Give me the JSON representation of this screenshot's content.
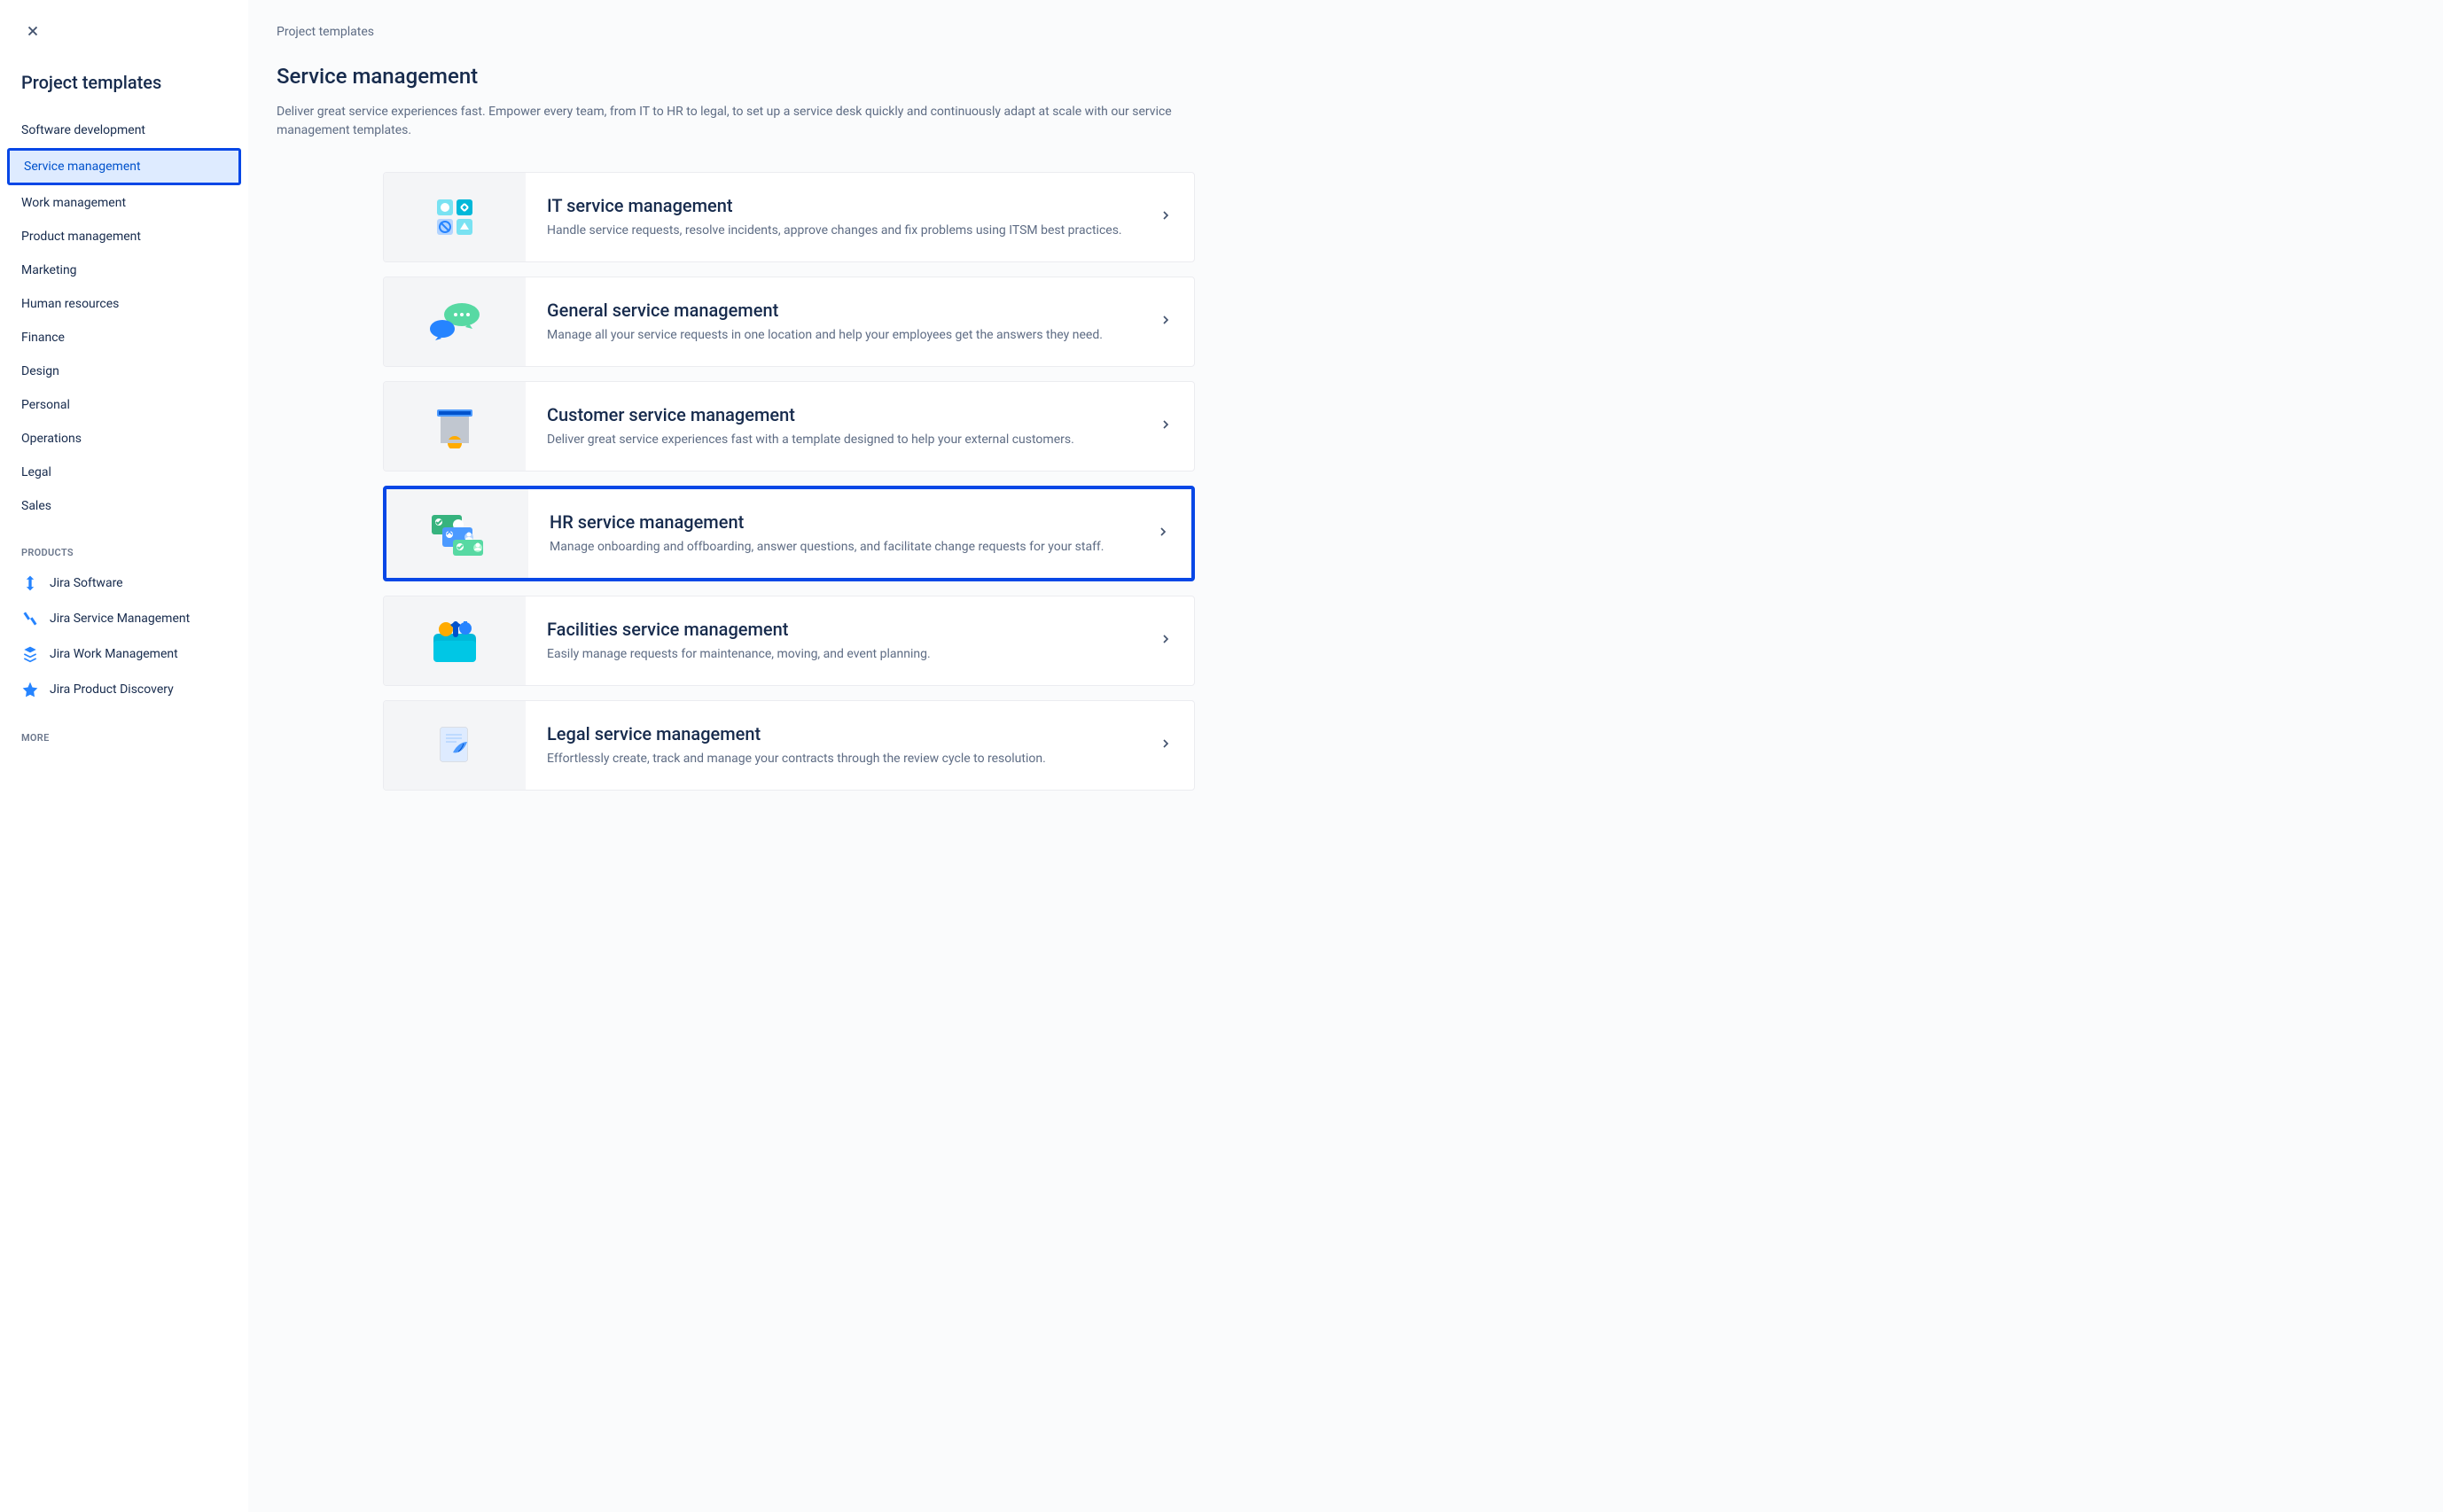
{
  "sidebar": {
    "title": "Project templates",
    "categories": [
      {
        "label": "Software development",
        "selected": false
      },
      {
        "label": "Service management",
        "selected": true
      },
      {
        "label": "Work management",
        "selected": false
      },
      {
        "label": "Product management",
        "selected": false
      },
      {
        "label": "Marketing",
        "selected": false
      },
      {
        "label": "Human resources",
        "selected": false
      },
      {
        "label": "Finance",
        "selected": false
      },
      {
        "label": "Design",
        "selected": false
      },
      {
        "label": "Personal",
        "selected": false
      },
      {
        "label": "Operations",
        "selected": false
      },
      {
        "label": "Legal",
        "selected": false
      },
      {
        "label": "Sales",
        "selected": false
      }
    ],
    "productsLabel": "PRODUCTS",
    "products": [
      {
        "label": "Jira Software",
        "icon": "jira-software"
      },
      {
        "label": "Jira Service Management",
        "icon": "jira-service"
      },
      {
        "label": "Jira Work Management",
        "icon": "jira-work"
      },
      {
        "label": "Jira Product Discovery",
        "icon": "jira-discovery"
      }
    ],
    "moreLabel": "MORE"
  },
  "main": {
    "breadcrumb": "Project templates",
    "title": "Service management",
    "description": "Deliver great service experiences fast. Empower every team, from IT to HR to legal, to set up a service desk quickly and continuously adapt at scale with our service management templates.",
    "templates": [
      {
        "title": "IT service management",
        "description": "Handle service requests, resolve incidents, approve changes and fix problems using ITSM best practices.",
        "highlighted": false,
        "icon": "itsm"
      },
      {
        "title": "General service management",
        "description": "Manage all your service requests in one location and help your employees get the answers they need.",
        "highlighted": false,
        "icon": "general"
      },
      {
        "title": "Customer service management",
        "description": "Deliver great service experiences fast with a template designed to help your external customers.",
        "highlighted": false,
        "icon": "customer"
      },
      {
        "title": "HR service management",
        "description": "Manage onboarding and offboarding, answer questions, and facilitate change requests for your staff.",
        "highlighted": true,
        "icon": "hr"
      },
      {
        "title": "Facilities service management",
        "description": "Easily manage requests for maintenance, moving, and event planning.",
        "highlighted": false,
        "icon": "facilities"
      },
      {
        "title": "Legal service management",
        "description": "Effortlessly create, track and manage your contracts through the review cycle to resolution.",
        "highlighted": false,
        "icon": "legal"
      }
    ]
  }
}
